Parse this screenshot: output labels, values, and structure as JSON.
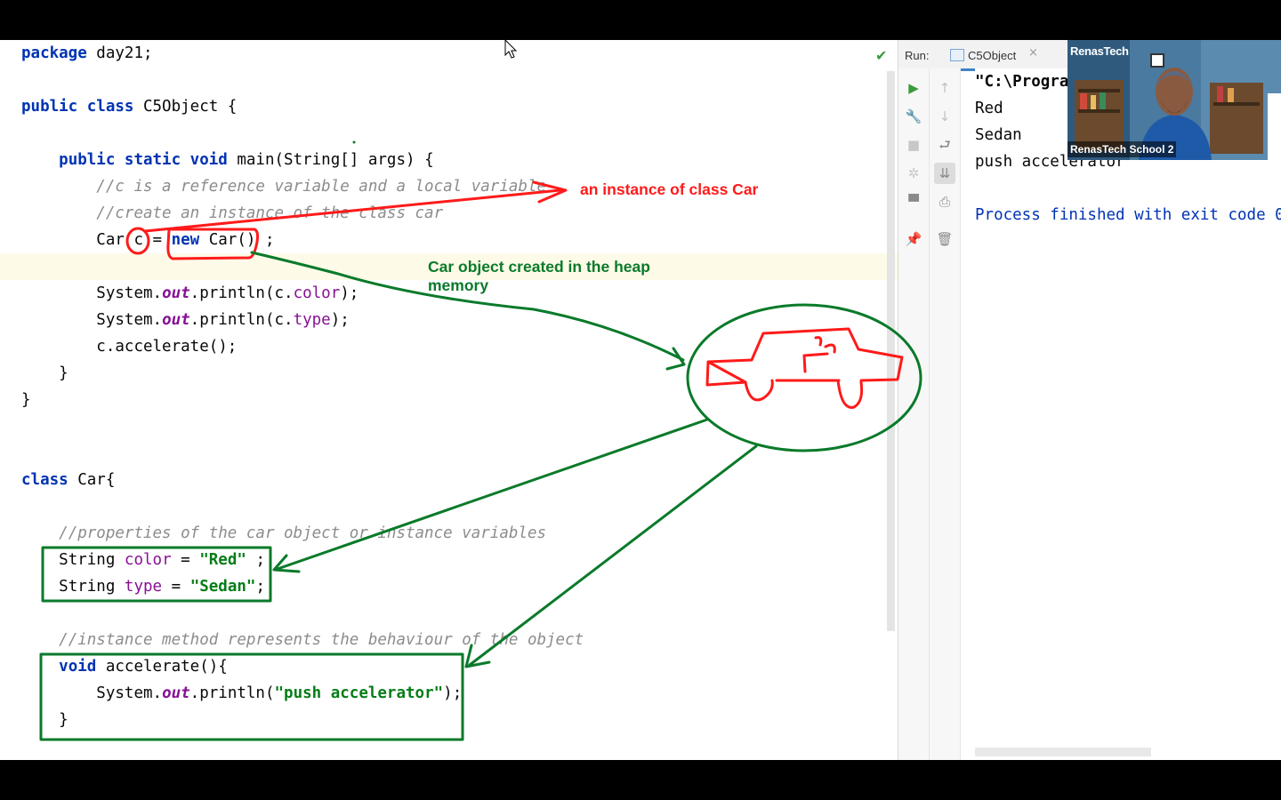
{
  "editor": {
    "lines": [
      {
        "indent": "",
        "parts": [
          {
            "t": "package",
            "c": "kw"
          },
          {
            "t": " day21;"
          }
        ]
      },
      {
        "indent": "",
        "parts": []
      },
      {
        "indent": "",
        "parts": [
          {
            "t": "public class",
            "c": "kw"
          },
          {
            "t": " C5Object {"
          }
        ]
      },
      {
        "indent": "",
        "parts": []
      },
      {
        "indent": "    ",
        "parts": [
          {
            "t": "public static void",
            "c": "kw"
          },
          {
            "t": " main(String[] args) {"
          }
        ]
      },
      {
        "indent": "        ",
        "parts": [
          {
            "t": "//c is a reference variable and a local variable",
            "c": "cm"
          }
        ]
      },
      {
        "indent": "        ",
        "parts": [
          {
            "t": "//create an instance of the class car",
            "c": "cm"
          }
        ]
      },
      {
        "indent": "        ",
        "parts": [
          {
            "t": "Car c = "
          },
          {
            "t": "new",
            "c": "kw"
          },
          {
            "t": " Car() ;"
          }
        ]
      },
      {
        "indent": "",
        "parts": []
      },
      {
        "indent": "        ",
        "parts": [
          {
            "t": "System."
          },
          {
            "t": "out",
            "c": "sfld"
          },
          {
            "t": ".println(c."
          },
          {
            "t": "color",
            "c": "fld"
          },
          {
            "t": ");"
          }
        ]
      },
      {
        "indent": "        ",
        "parts": [
          {
            "t": "System."
          },
          {
            "t": "out",
            "c": "sfld"
          },
          {
            "t": ".println(c."
          },
          {
            "t": "type",
            "c": "fld"
          },
          {
            "t": ");"
          }
        ]
      },
      {
        "indent": "        ",
        "parts": [
          {
            "t": "c.accelerate();"
          }
        ]
      },
      {
        "indent": "    ",
        "parts": [
          {
            "t": "}"
          }
        ]
      },
      {
        "indent": "",
        "parts": [
          {
            "t": "}"
          }
        ]
      },
      {
        "indent": "",
        "parts": []
      },
      {
        "indent": "",
        "parts": []
      },
      {
        "indent": "",
        "parts": [
          {
            "t": "class",
            "c": "kw"
          },
          {
            "t": " Car{"
          }
        ]
      },
      {
        "indent": "",
        "parts": []
      },
      {
        "indent": "    ",
        "parts": [
          {
            "t": "//properties of the car object or instance variables",
            "c": "cm"
          }
        ]
      },
      {
        "indent": "    ",
        "parts": [
          {
            "t": "String "
          },
          {
            "t": "color",
            "c": "fld"
          },
          {
            "t": " = "
          },
          {
            "t": "\"Red\"",
            "c": "str"
          },
          {
            "t": " ;"
          }
        ]
      },
      {
        "indent": "    ",
        "parts": [
          {
            "t": "String "
          },
          {
            "t": "type",
            "c": "fld"
          },
          {
            "t": " = "
          },
          {
            "t": "\"Sedan\"",
            "c": "str"
          },
          {
            "t": ";"
          }
        ]
      },
      {
        "indent": "",
        "parts": []
      },
      {
        "indent": "    ",
        "parts": [
          {
            "t": "//instance method represents the behaviour of the object",
            "c": "cm"
          }
        ]
      },
      {
        "indent": "    ",
        "parts": [
          {
            "t": "void",
            "c": "kw"
          },
          {
            "t": " accelerate(){"
          }
        ]
      },
      {
        "indent": "        ",
        "parts": [
          {
            "t": "System."
          },
          {
            "t": "out",
            "c": "sfld"
          },
          {
            "t": ".println("
          },
          {
            "t": "\"push accelerator\"",
            "c": "str"
          },
          {
            "t": ");"
          }
        ]
      },
      {
        "indent": "    ",
        "parts": [
          {
            "t": "}"
          }
        ]
      }
    ]
  },
  "run_panel": {
    "label": "Run:",
    "tab_name": "C5Object",
    "tab_close": "×",
    "left_tools": [
      {
        "name": "run-icon",
        "glyph": "▶",
        "color": "#3a9b3a"
      },
      {
        "name": "wrench-icon",
        "glyph": "🔧",
        "color": "#8a8a8a"
      },
      {
        "name": "stop-icon",
        "glyph": "■",
        "color": "#c8c8c8"
      },
      {
        "name": "debug-bug-icon",
        "glyph": "✲",
        "color": "#c8c8c8"
      },
      {
        "name": "layout-icon",
        "glyph": "▀",
        "color": "#8a8a8a"
      },
      {
        "name": "pin-icon",
        "glyph": "📌",
        "color": "#8a8a8a"
      }
    ],
    "right_tools": [
      {
        "name": "up-arrow-icon",
        "glyph": "↑",
        "color": "#c0c0c0"
      },
      {
        "name": "down-arrow-icon",
        "glyph": "↓",
        "color": "#c0c0c0"
      },
      {
        "name": "soft-wrap-icon",
        "glyph": "⮐",
        "color": "#8a8a8a"
      },
      {
        "name": "scroll-to-end-icon",
        "glyph": "⇊",
        "color": "#8a8a8a"
      },
      {
        "name": "print-icon",
        "glyph": "⎙",
        "color": "#8a8a8a"
      },
      {
        "name": "trash-icon",
        "glyph": "🗑",
        "color": "#8a8a8a"
      }
    ],
    "console_lines": [
      {
        "text": "\"C:\\Program Files\\Java\\jdk",
        "color": "#080808",
        "bold": true
      },
      {
        "text": "Red",
        "color": "#080808",
        "bold": false
      },
      {
        "text": "Sedan",
        "color": "#080808",
        "bold": false
      },
      {
        "text": "push accelerator",
        "color": "#080808",
        "bold": false
      },
      {
        "text": "",
        "color": "#080808",
        "bold": false
      },
      {
        "text": "Process finished with exit code 0",
        "color": "#0033b3",
        "bold": false
      }
    ]
  },
  "webcam": {
    "brand": "RenasTech",
    "caption": "RenasTech School 2"
  },
  "annotations": {
    "instance_label": "an instance of class Car",
    "heap_label_1": "Car object created in the heap",
    "heap_label_2": "memory",
    "red": "#ff1a1a",
    "green": "#0a7a2a"
  }
}
